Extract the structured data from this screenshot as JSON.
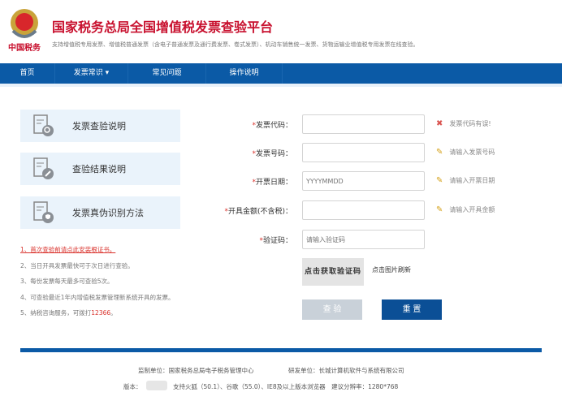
{
  "header": {
    "title": "国家税务总局全国增值税发票查验平台",
    "subtitle": "支持增值税专用发票、增值税普通发票（含电子普通发票及通行费发票、卷式发票）、机动车销售统一发票、货物运输业增值税专用发票在线查验。",
    "logo_text": "中国税务"
  },
  "nav": [
    {
      "label": "首页"
    },
    {
      "label": "发票常识 ▾"
    },
    {
      "label": "常见问题"
    },
    {
      "label": "操作说明"
    }
  ],
  "cards": [
    {
      "label": "发票查验说明",
      "icon": "document-search-icon"
    },
    {
      "label": "查验结果说明",
      "icon": "document-edit-icon"
    },
    {
      "label": "发票真伪识别方法",
      "icon": "document-shield-icon"
    }
  ],
  "notes": [
    "1、首次查验前请点此安装根证书。",
    "2、当日开具发票最快可于次日进行查验。",
    "3、每份发票每天最多可查验5次。",
    "4、可查验最近1年内增值税发票管理新系统开具的发票。",
    "5、纳税咨询服务，可拨打",
    "12366",
    "。"
  ],
  "form": {
    "fields": [
      {
        "label": "发票代码：",
        "value": "",
        "placeholder": "",
        "hint": "发票代码有误!",
        "hint_icon": "error-x-icon"
      },
      {
        "label": "发票号码：",
        "value": "",
        "placeholder": "",
        "hint": "请输入发票号码",
        "hint_icon": "pencil-icon"
      },
      {
        "label": "开票日期：",
        "value": "",
        "placeholder": "YYYYMMDD",
        "hint": "请输入开票日期",
        "hint_icon": "pencil-icon"
      },
      {
        "label": "开具金额(不含税)：",
        "value": "",
        "placeholder": "",
        "hint": "请输入开具金额",
        "hint_icon": "pencil-icon"
      },
      {
        "label": "验证码：",
        "value": "",
        "placeholder": "请输入验证码"
      }
    ],
    "required_mark": "*",
    "captcha_text": "点击获取验证码",
    "refresh_text": "点击图片刷新",
    "check_label": "查 验",
    "reset_label": "重 置"
  },
  "colors": {
    "brand_red": "#c8102e",
    "nav_blue": "#0b5aa6",
    "button_blue": "#0b4f96",
    "button_disabled": "#c9d1d9"
  },
  "footer": {
    "line1a": "监制单位：国家税务总局电子税务管理中心",
    "line1b": "研发单位：长城计算机软件与系统有限公司",
    "version_label": "版本：",
    "line2": "支持火狐（50.1）、谷歌（55.0）、IE8及以上版本浏览器　建议分辨率：1280*768"
  }
}
